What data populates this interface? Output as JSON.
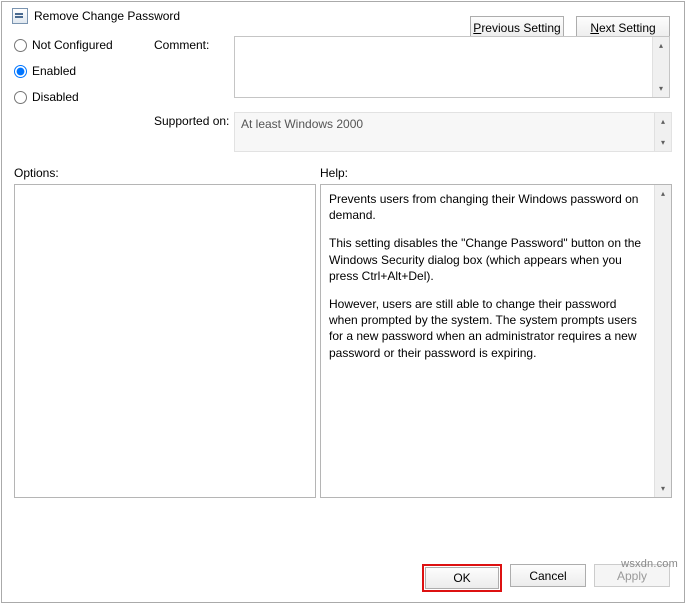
{
  "window": {
    "title": "Remove Change Password"
  },
  "nav": {
    "previous_label": "Previous Setting",
    "previous_underline": "P",
    "next_label": "Next Setting",
    "next_underline": "N"
  },
  "radios": {
    "not_configured": "Not Configured",
    "enabled": "Enabled",
    "disabled": "Disabled",
    "selected": "enabled"
  },
  "fields": {
    "comment_label": "Comment:",
    "comment_value": "",
    "supported_label": "Supported on:",
    "supported_value": "At least Windows 2000"
  },
  "sections": {
    "options_label": "Options:",
    "help_label": "Help:"
  },
  "help": {
    "p1": "Prevents users from changing their Windows password on demand.",
    "p2": "This setting disables the \"Change Password\" button on the Windows Security dialog box (which appears when you press Ctrl+Alt+Del).",
    "p3": "However, users are still able to change their password when prompted by the system. The system prompts users for a new password when an administrator requires a new password or their password is expiring."
  },
  "buttons": {
    "ok": "OK",
    "cancel": "Cancel",
    "apply": "Apply"
  },
  "watermark": "wsxdn.com"
}
